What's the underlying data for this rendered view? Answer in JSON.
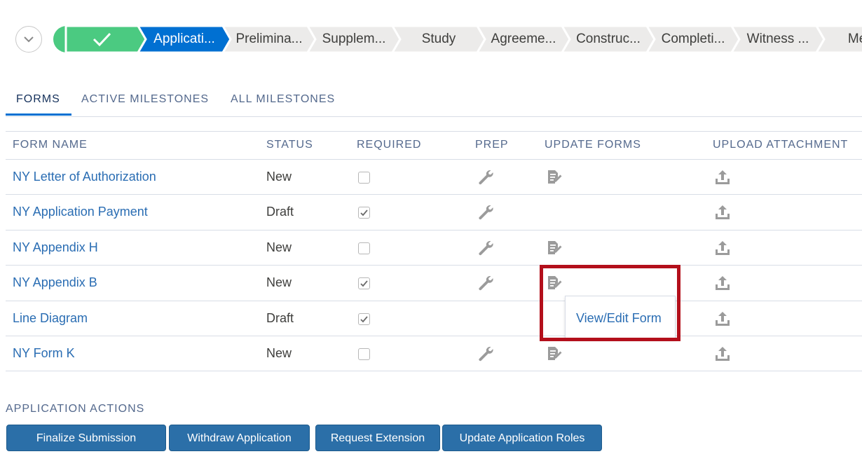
{
  "path": {
    "toggle_icon": "chevron-down-icon",
    "completed_icon": "check-icon",
    "colors": {
      "completed": "#4bca81",
      "current": "#0070d2",
      "incomplete": "#ecebea"
    },
    "stages": [
      {
        "label": "",
        "state": "completed"
      },
      {
        "label": "Applicati...",
        "state": "current"
      },
      {
        "label": "Prelimina...",
        "state": "incomplete"
      },
      {
        "label": "Supplem...",
        "state": "incomplete"
      },
      {
        "label": "Study",
        "state": "incomplete"
      },
      {
        "label": "Agreeme...",
        "state": "incomplete"
      },
      {
        "label": "Construc...",
        "state": "incomplete"
      },
      {
        "label": "Completi...",
        "state": "incomplete"
      },
      {
        "label": "Witness ...",
        "state": "incomplete"
      },
      {
        "label": "Mete",
        "state": "incomplete"
      }
    ]
  },
  "tabs": [
    {
      "label": "FORMS",
      "active": true
    },
    {
      "label": "ACTIVE MILESTONES",
      "active": false
    },
    {
      "label": "ALL MILESTONES",
      "active": false
    }
  ],
  "table": {
    "headers": {
      "form_name": "FORM NAME",
      "status": "STATUS",
      "required": "REQUIRED",
      "prep": "PREP",
      "update_forms": "UPDATE FORMS",
      "upload_attachment": "UPLOAD ATTACHMENT"
    },
    "rows": [
      {
        "name": "NY Letter of Authorization",
        "status": "New",
        "required": false,
        "prep": true,
        "update": true,
        "upload": true
      },
      {
        "name": "NY Application Payment",
        "status": "Draft",
        "required": true,
        "prep": true,
        "update": false,
        "upload": true
      },
      {
        "name": "NY Appendix H",
        "status": "New",
        "required": false,
        "prep": true,
        "update": true,
        "upload": true
      },
      {
        "name": "NY Appendix B",
        "status": "New",
        "required": true,
        "prep": true,
        "update": true,
        "upload": true
      },
      {
        "name": "Line Diagram",
        "status": "Draft",
        "required": true,
        "prep": false,
        "update": false,
        "upload": true
      },
      {
        "name": "NY Form K",
        "status": "New",
        "required": false,
        "prep": true,
        "update": true,
        "upload": true
      }
    ],
    "icons": {
      "prep": "wrench-icon",
      "update": "edit-form-icon",
      "upload": "upload-icon"
    }
  },
  "tooltip": {
    "label": "View/Edit Form",
    "highlight_color": "#b30f1b"
  },
  "actions": {
    "title": "APPLICATION ACTIONS",
    "buttons": [
      {
        "label": "Finalize Submission"
      },
      {
        "label": "Withdraw Application"
      },
      {
        "label": "Request Extension"
      },
      {
        "label": "Update Application Roles"
      }
    ]
  }
}
